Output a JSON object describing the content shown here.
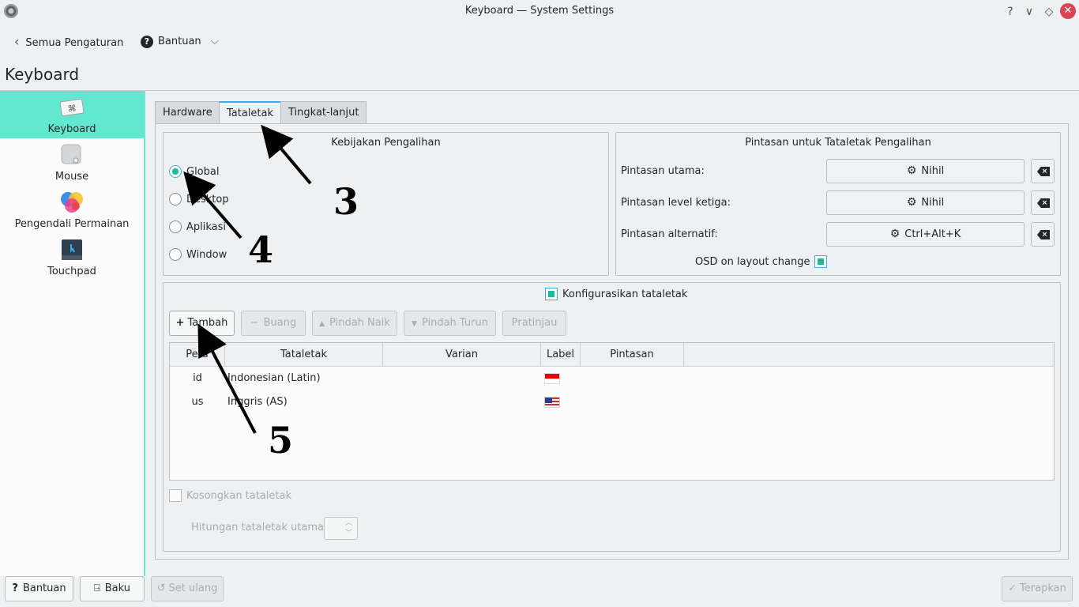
{
  "window": {
    "title": "Keyboard — System Settings",
    "help": "?",
    "minimize": "∨",
    "maximize": "◇",
    "close": "✕"
  },
  "toolbar": {
    "back_label": "Semua Pengaturan",
    "help_label": "Bantuan"
  },
  "page": {
    "title": "Keyboard"
  },
  "sidebar": {
    "items": [
      {
        "label": "Keyboard",
        "icon": "keyboard-icon"
      },
      {
        "label": "Mouse",
        "icon": "mouse-icon"
      },
      {
        "label": "Pengendali Permainan",
        "icon": "gamepad-icon"
      },
      {
        "label": "Touchpad",
        "icon": "touchpad-icon"
      }
    ]
  },
  "tabs": [
    {
      "label": "Hardware"
    },
    {
      "label": "Tataletak"
    },
    {
      "label": "Tingkat-lanjut"
    }
  ],
  "switching_policy": {
    "title": "Kebijakan Pengalihan",
    "options": [
      {
        "label": "Global",
        "checked": true
      },
      {
        "label": "Desktop"
      },
      {
        "label": "Aplikasi"
      },
      {
        "label": "Window"
      }
    ]
  },
  "shortcuts": {
    "title": "Pintasan untuk Tataletak Pengalihan",
    "main_label": "Pintasan utama:",
    "main_value": "Nihil",
    "third_label": "Pintasan level ketiga:",
    "third_value": "Nihil",
    "alt_label": "Pintasan alternatif:",
    "alt_value": "Ctrl+Alt+K",
    "osd_label": "OSD on layout change"
  },
  "layouts": {
    "configure_label": "Konfigurasikan tataletak",
    "buttons": {
      "add": "Tambah",
      "remove": "Buang",
      "move_up": "Pindah Naik",
      "move_down": "Pindah Turun",
      "preview": "Pratinjau"
    },
    "columns": [
      "Peta",
      "Tataletak",
      "Varian",
      "Label",
      "Pintasan"
    ],
    "rows": [
      {
        "map": "id",
        "layout": "Indonesian (Latin)",
        "flag": "flag-indonesia"
      },
      {
        "map": "us",
        "layout": "Inggris (AS)",
        "flag": "flag-usa"
      }
    ],
    "clear_label": "Kosongkan tataletak",
    "main_count_label": "Hitungan tataletak utama:"
  },
  "bottom": {
    "help": "Bantuan",
    "defaults": "Baku",
    "reset": "Set ulang",
    "apply": "Terapkan"
  },
  "annotations": {
    "n3": "3",
    "n4": "4",
    "n5": "5"
  }
}
